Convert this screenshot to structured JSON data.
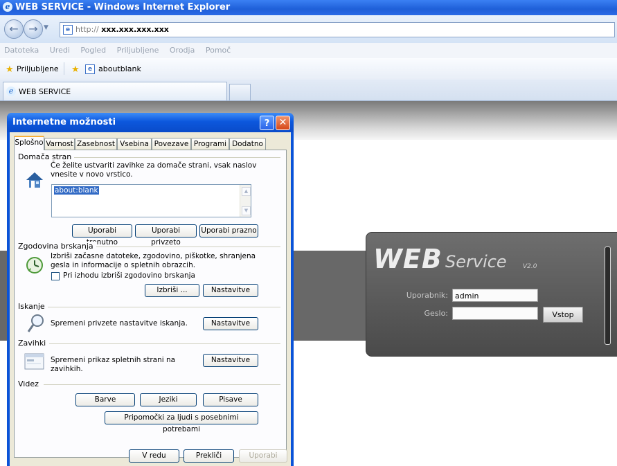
{
  "window": {
    "title": "WEB SERVICE - Windows Internet Explorer"
  },
  "address": {
    "prefix": "http://",
    "host": "xxx.xxx.xxx.xxx"
  },
  "menu": [
    "Datoteka",
    "Uredi",
    "Pogled",
    "Priljubljene",
    "Orodja",
    "Pomoč"
  ],
  "favorites": {
    "label": "Priljubljene",
    "item": "aboutblank"
  },
  "tabs": {
    "active": "WEB SERVICE"
  },
  "login": {
    "logo_main": "WEB",
    "logo_sub": "Service",
    "logo_version": "V2.0",
    "user_label": "Uporabnik:",
    "user_value": "admin",
    "pass_label": "Geslo:",
    "pass_value": "",
    "submit": "Vstop"
  },
  "dialog": {
    "title": "Internetne možnosti",
    "tabs": [
      "Splošno",
      "Varnost",
      "Zasebnost",
      "Vsebina",
      "Povezave",
      "Programi",
      "Dodatno"
    ],
    "home": {
      "group": "Domača stran",
      "text": "Če želite ustvariti zavihke za domače strani, vsak naslov vnesite v novo vrstico.",
      "url": "about:blank",
      "btn_current": "Uporabi trenutno",
      "btn_default": "Uporabi privzeto",
      "btn_blank": "Uporabi prazno"
    },
    "history": {
      "group": "Zgodovina brskanja",
      "text": "Izbriši začasne datoteke, zgodovino, piškotke, shranjena gesla in informacije o spletnih obrazcih.",
      "checkbox": "Pri izhodu izbriši zgodovino brskanja",
      "btn_delete": "Izbriši ...",
      "btn_settings": "Nastavitve"
    },
    "search": {
      "group": "Iskanje",
      "text": "Spremeni privzete nastavitve iskanja.",
      "btn_settings": "Nastavitve"
    },
    "tabsgroup": {
      "group": "Zavihki",
      "text": "Spremeni prikaz spletnih strani na zavihkih.",
      "btn_settings": "Nastavitve"
    },
    "look": {
      "group": "Videz",
      "btn_colors": "Barve",
      "btn_languages": "Jeziki",
      "btn_fonts": "Pisave",
      "btn_access": "Pripomočki za ljudi s posebnimi potrebami"
    },
    "footer": {
      "ok": "V redu",
      "cancel": "Prekliči",
      "apply": "Uporabi"
    }
  }
}
